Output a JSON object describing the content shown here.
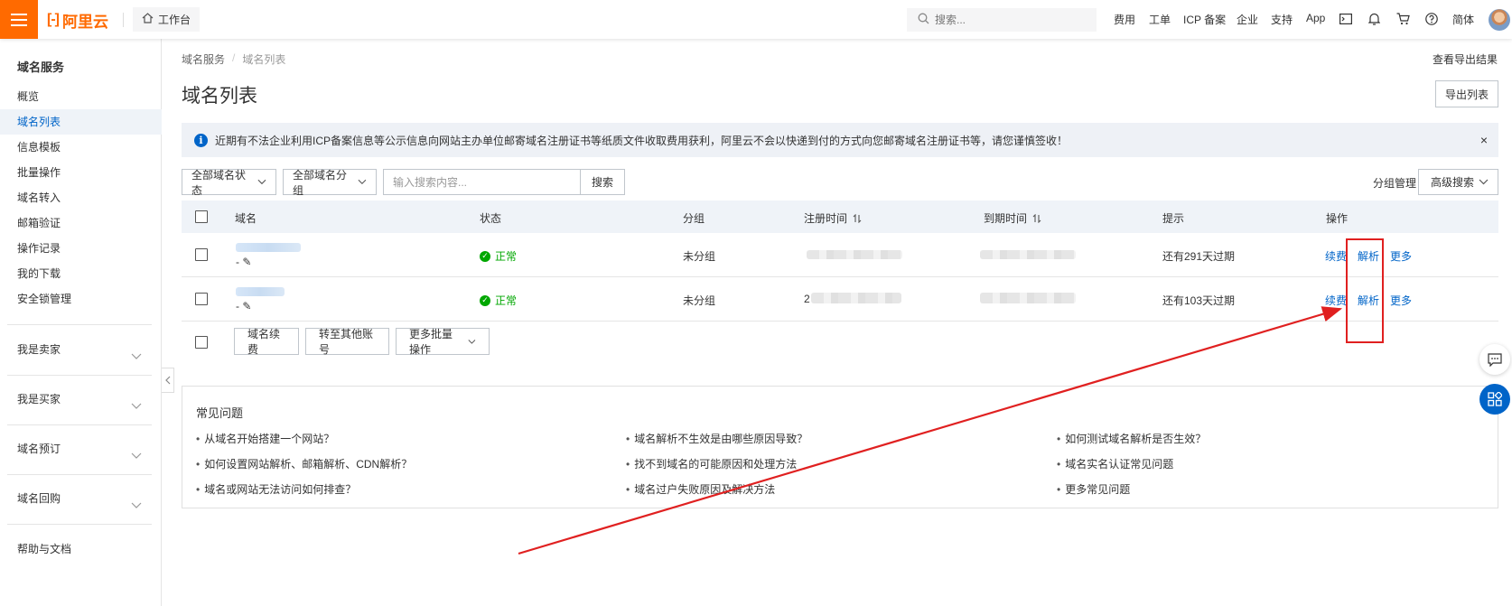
{
  "topbar": {
    "logo_text": "阿里云",
    "logo_mark": "[-]",
    "workbench_label": "工作台",
    "search_placeholder": "搜索...",
    "nav": [
      "费用",
      "工单",
      "ICP 备案",
      "企业",
      "支持",
      "App"
    ],
    "lang_label": "简体"
  },
  "sidebar": {
    "title": "域名服务",
    "items": [
      {
        "label": "概览",
        "active": false
      },
      {
        "label": "域名列表",
        "active": true
      },
      {
        "label": "信息模板",
        "active": false
      },
      {
        "label": "批量操作",
        "active": false
      },
      {
        "label": "域名转入",
        "active": false
      },
      {
        "label": "邮箱验证",
        "active": false
      },
      {
        "label": "操作记录",
        "active": false
      },
      {
        "label": "我的下载",
        "active": false
      },
      {
        "label": "安全锁管理",
        "active": false
      }
    ],
    "groups": [
      "我是卖家",
      "我是买家",
      "域名预订",
      "域名回购"
    ],
    "help": "帮助与文档"
  },
  "breadcrumb": {
    "parent": "域名服务",
    "current": "域名列表"
  },
  "header": {
    "title": "域名列表",
    "export_result_link": "查看导出结果",
    "export_button": "导出列表"
  },
  "notice": {
    "text": "近期有不法企业利用ICP备案信息等公示信息向网站主办单位邮寄域名注册证书等纸质文件收取费用获利，阿里云不会以快递到付的方式向您邮寄域名注册证书等，请您谨慎签收！",
    "close": "×"
  },
  "filters": {
    "status_select": "全部域名状态",
    "group_select": "全部域名分组",
    "search_placeholder": "输入搜索内容...",
    "search_button": "搜索",
    "group_manage": "分组管理",
    "advanced_search": "高级搜索"
  },
  "table": {
    "columns": [
      "域名",
      "状态",
      "分组",
      "注册时间",
      "到期时间",
      "提示",
      "操作"
    ],
    "rows": [
      {
        "domain_suffix": "- ✎",
        "status": "正常",
        "group": "未分组",
        "reg_prefix": "",
        "tip": "还有291天过期",
        "actions": [
          "续费",
          "解析",
          "更多"
        ]
      },
      {
        "domain_suffix": "- ✎",
        "status": "正常",
        "group": "未分组",
        "reg_prefix": "2",
        "tip": "还有103天过期",
        "actions": [
          "续费",
          "解析",
          "更多"
        ]
      }
    ]
  },
  "bulk": {
    "renew": "域名续费",
    "transfer": "转至其他账号",
    "more": "更多批量操作"
  },
  "faq": {
    "title": "常见问题",
    "links": [
      [
        "从域名开始搭建一个网站？",
        "如何设置网站解析、邮箱解析、CDN解析？",
        "域名或网站无法访问如何排查？"
      ],
      [
        "域名解析不生效是由哪些原因导致？",
        "找不到域名的可能原因和处理方法",
        "域名过户失败原因及解决方法"
      ],
      [
        "如何测试域名解析是否生效？",
        "域名实名认证常见问题",
        "更多常见问题"
      ]
    ]
  },
  "colors": {
    "brand": "#ff6a00",
    "link": "#0064c8",
    "ok": "#00a700",
    "annotation": "#e02020"
  }
}
